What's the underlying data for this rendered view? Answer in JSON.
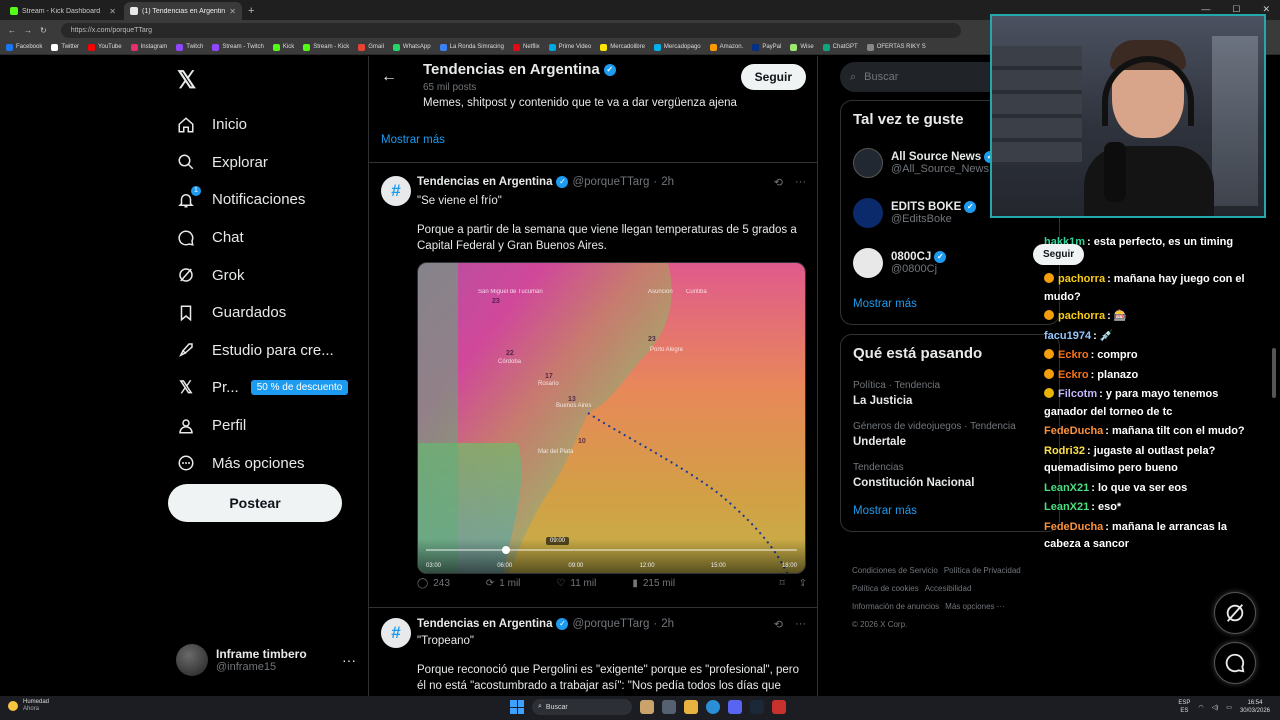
{
  "browser": {
    "tabs": [
      {
        "title": "Stream - Kick Dashboard",
        "color": "#53fc18",
        "active": false
      },
      {
        "title": "(1) Tendencias en Argentina (@porq",
        "color": "#e7e9ea",
        "active": true
      }
    ],
    "url": "https://x.com/porqueTTarg",
    "bookmarks": [
      {
        "label": "Facebook",
        "color": "#1877f2"
      },
      {
        "label": "Twitter",
        "color": "#ffffff"
      },
      {
        "label": "YouTube",
        "color": "#ff0000"
      },
      {
        "label": "Instagram",
        "color": "#e1306c"
      },
      {
        "label": "Twitch",
        "color": "#9146ff"
      },
      {
        "label": "Stream - Twitch",
        "color": "#9146ff"
      },
      {
        "label": "Kick",
        "color": "#53fc18"
      },
      {
        "label": "Stream - Kick",
        "color": "#53fc18"
      },
      {
        "label": "Gmail",
        "color": "#ea4335"
      },
      {
        "label": "WhatsApp",
        "color": "#25d366"
      },
      {
        "label": "La Ronda Simracing",
        "color": "#3b82f6"
      },
      {
        "label": "Netflix",
        "color": "#e50914"
      },
      {
        "label": "Prime Video",
        "color": "#00a8e1"
      },
      {
        "label": "Mercadolibre",
        "color": "#ffe600"
      },
      {
        "label": "Mercadopago",
        "color": "#00b1ea"
      },
      {
        "label": "Amazon.",
        "color": "#ff9900"
      },
      {
        "label": "PayPal",
        "color": "#003087"
      },
      {
        "label": "Wise",
        "color": "#9fe870"
      },
      {
        "label": "ChatGPT",
        "color": "#10a37f"
      },
      {
        "label": "OFERTAS RIKY S",
        "color": "#888888"
      }
    ]
  },
  "sidebar": {
    "items": [
      {
        "label": "Inicio",
        "icon": "home-icon"
      },
      {
        "label": "Explorar",
        "icon": "search-icon"
      },
      {
        "label": "Notificaciones",
        "icon": "bell-icon",
        "badge": "1"
      },
      {
        "label": "Chat",
        "icon": "chat-icon"
      },
      {
        "label": "Grok",
        "icon": "grok-icon"
      },
      {
        "label": "Guardados",
        "icon": "bookmark-icon"
      },
      {
        "label": "Estudio para cre...",
        "icon": "rocket-icon"
      },
      {
        "label": "Pr...",
        "icon": "x-premium-icon",
        "promo": "50 % de descuento"
      },
      {
        "label": "Perfil",
        "icon": "person-icon"
      },
      {
        "label": "Más opciones",
        "icon": "more-circle-icon"
      }
    ],
    "post_label": "Postear",
    "account": {
      "name": "Inframe timbero",
      "handle": "@inframe15"
    }
  },
  "profile_header": {
    "title": "Tendencias en Argentina",
    "posts_count": "65 mil posts",
    "follow_label": "Seguir",
    "description": "Memes, shitpost y contenido que te va a dar vergüenza ajena",
    "show_more": "Mostrar más"
  },
  "tweets": [
    {
      "name": "Tendencias en Argentina",
      "handle": "@porqueTTarg",
      "time": "2h",
      "line1": "\"Se viene el frío\"",
      "line2": "Porque a partir de la semana que viene llegan temperaturas de 5 grados a Capital Federal y Gran Buenos Aires.",
      "video": {
        "times": [
          "03:00",
          "06:00",
          "09:00",
          "12:00",
          "15:00",
          "18:00"
        ],
        "current": "09:00"
      },
      "stats": {
        "replies": "243",
        "reposts": "1 mil",
        "likes": "11 mil",
        "views": "215 mil"
      }
    },
    {
      "name": "Tendencias en Argentina",
      "handle": "@porqueTTarg",
      "time": "2h",
      "line1": "\"Tropeano\"",
      "line2": "Porque reconoció que Pergolini es \"exigente\" porque es \"profesional\", pero él no está \"acostumbrado a trabajar así\": \"Nos pedía todos los días que"
    }
  ],
  "right": {
    "search_placeholder": "Buscar",
    "suggest_title": "Tal vez te guste",
    "suggestions": [
      {
        "name": "All Source News",
        "handle": "@All_Source_News",
        "color": "#222831"
      },
      {
        "name": "EDITS BOKE",
        "handle": "@EditsBoke",
        "color": "#0b2a6b"
      },
      {
        "name": "0800CJ",
        "handle": "@0800Cj",
        "color": "#e8e8e8"
      }
    ],
    "show_more": "Mostrar más",
    "trends_title": "Qué está pasando",
    "trends": [
      {
        "category": "Política · Tendencia",
        "name": "La Justicia"
      },
      {
        "category": "Géneros de videojuegos · Tendencia",
        "name": "Undertale"
      },
      {
        "category": "Tendencias",
        "name": "Constitución Nacional"
      }
    ],
    "trends_more": "Mostrar más",
    "footer": [
      "Condiciones de Servicio",
      "Política de Privacidad",
      "Política de cookies",
      "Accesibilidad",
      "Información de anuncios",
      "Más opciones ···",
      "© 2026 X Corp."
    ]
  },
  "overlay": {
    "follow_label": "Seguir",
    "chat": [
      {
        "user": "hakk1m",
        "color": "#34d399",
        "text": ": esta perfecto, es un timing ideal"
      },
      {
        "user": "pachorra",
        "color": "#facc15",
        "text": ": mañana hay juego con el mudo?",
        "icon": "#f59e0b"
      },
      {
        "user": "pachorra",
        "color": "#facc15",
        "text": ": 🎰",
        "icon": "#f59e0b"
      },
      {
        "user": "facu1974",
        "color": "#93c5fd",
        "text": ": 💉"
      },
      {
        "user": "Eckro",
        "color": "#f97316",
        "text": ": compro",
        "icon": "#f59e0b"
      },
      {
        "user": "Eckro",
        "color": "#f97316",
        "text": ": planazo",
        "icon": "#f59e0b"
      },
      {
        "user": "Filcotm",
        "color": "#c4b5fd",
        "text": ": y para mayo tenemos ganador del torneo de tc",
        "icon": "#eab308"
      },
      {
        "user": "FedeDucha",
        "color": "#fb923c",
        "text": ": mañana tilt con el mudo?"
      },
      {
        "user": "Rodri32",
        "color": "#fde047",
        "text": ": jugaste al outlast pela? quemadisimo pero bueno"
      },
      {
        "user": "LeanX21",
        "color": "#4ade80",
        "text": ": lo que va ser eos"
      },
      {
        "user": "LeanX21",
        "color": "#4ade80",
        "text": ": eso*"
      },
      {
        "user": "FedeDucha",
        "color": "#fb923c",
        "text": ": mañana le arrancas la cabeza a sancor"
      }
    ]
  },
  "taskbar": {
    "weather_title": "Humedad",
    "weather_sub": "Ahora",
    "search_label": "Buscar",
    "lang1": "ESP",
    "lang2": "ES",
    "time": "16:54",
    "date": "30/03/2026"
  }
}
